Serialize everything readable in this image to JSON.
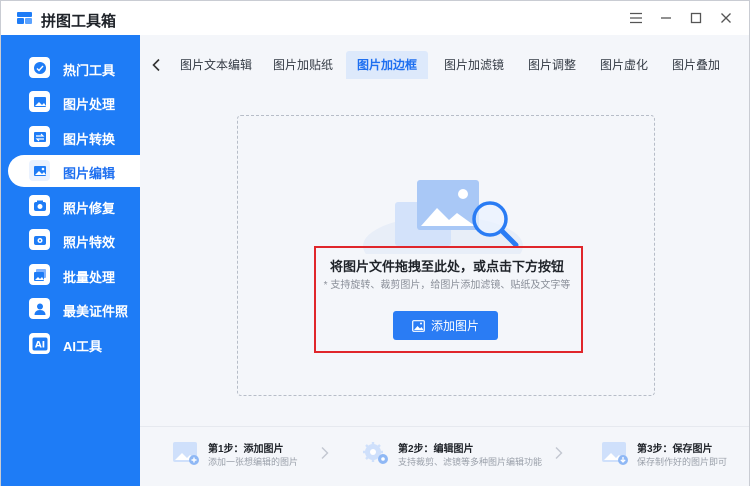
{
  "window": {
    "title": "拼图工具箱",
    "controls": [
      "menu-icon",
      "minimize-icon",
      "maximize-icon",
      "close-icon"
    ]
  },
  "sidebar": {
    "items": [
      {
        "label": "热门工具",
        "icon": "hot-tools-icon"
      },
      {
        "label": "图片处理",
        "icon": "image-process-icon"
      },
      {
        "label": "图片转换",
        "icon": "image-convert-icon"
      },
      {
        "label": "图片编辑",
        "icon": "image-edit-icon",
        "active": true
      },
      {
        "label": "照片修复",
        "icon": "photo-repair-icon"
      },
      {
        "label": "照片特效",
        "icon": "photo-effect-icon"
      },
      {
        "label": "批量处理",
        "icon": "batch-process-icon"
      },
      {
        "label": "最美证件照",
        "icon": "id-photo-icon"
      },
      {
        "label": "AI工具",
        "icon": "ai-tools-icon"
      }
    ]
  },
  "tabs": {
    "items": [
      {
        "label": "图片文本编辑"
      },
      {
        "label": "图片加贴纸"
      },
      {
        "label": "图片加边框",
        "active": true
      },
      {
        "label": "图片加滤镜"
      },
      {
        "label": "图片调整"
      },
      {
        "label": "图片虚化"
      },
      {
        "label": "图片叠加"
      }
    ]
  },
  "dropzone": {
    "title": "将图片文件拖拽至此处，或点击下方按钮",
    "subtitle": "* 支持旋转、裁剪图片，给图片添加滤镜、贴纸及文字等",
    "button_label": "添加图片"
  },
  "steps": [
    {
      "title": "第1步：添加图片",
      "desc": "添加一张想编辑的图片"
    },
    {
      "title": "第2步：编辑图片",
      "desc": "支持裁剪、滤镜等多种图片编辑功能"
    },
    {
      "title": "第3步：保存图片",
      "desc": "保存制作好的图片即可"
    }
  ],
  "colors": {
    "sidebar_bg": "#1e7cf6",
    "accent": "#2a7cf4",
    "highlight": "#e0262b",
    "main_bg": "#f4f6fa"
  }
}
